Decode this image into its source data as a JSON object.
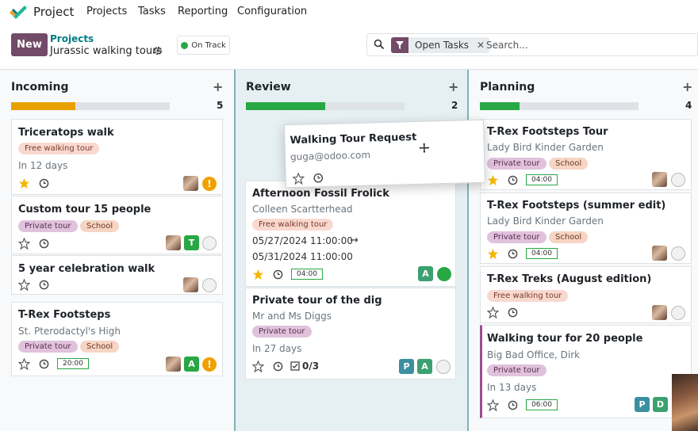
{
  "nav": {
    "app_name": "Project",
    "menu": [
      "Projects",
      "Tasks",
      "Reporting",
      "Configuration"
    ]
  },
  "control_panel": {
    "new_label": "New",
    "breadcrumb_parent": "Projects",
    "breadcrumb_current": "Jurassic walking tours",
    "status_label": "On Track",
    "search_facet": "Open Tasks",
    "search_placeholder": "Search..."
  },
  "colors": {
    "brand": "#714b67",
    "link": "#017e84",
    "incoming_progress": "#e8a000",
    "progress_green": "#28a745",
    "review_column_bg": "#e6f0f2"
  },
  "columns": [
    {
      "title": "Incoming",
      "count": "5",
      "progress": 0.4,
      "cards": [
        {
          "title": "Triceratops walk",
          "tags": [
            "Free walking tour"
          ],
          "deadline": "In 12 days",
          "starred": true,
          "avatars": [
            "photo"
          ],
          "status": "warning"
        },
        {
          "title": "Custom tour 15 people",
          "tags": [
            "Private tour",
            "School"
          ],
          "starred": false,
          "avatars": [
            "photo",
            "T"
          ],
          "status": "normal"
        },
        {
          "title": "5 year celebration walk",
          "starred": false,
          "avatars": [
            "photo"
          ],
          "status": "normal"
        },
        {
          "title": "T-Rex Footsteps",
          "subtitle": "St. Pterodactyl's High",
          "tags": [
            "Private tour",
            "School"
          ],
          "time": "20:00",
          "starred": false,
          "avatars": [
            "photo",
            "A"
          ],
          "status": "warning"
        }
      ]
    },
    {
      "title": "Review",
      "count": "2",
      "progress": 0.5,
      "cards": [
        {
          "title": "Afternoon Fossil Frolick",
          "subtitle": "Colleen Scartterhead",
          "tags": [
            "Free walking tour"
          ],
          "date_start": "05/27/2024 11:00:00",
          "date_end": "05/31/2024 11:00:00",
          "arrow": "→",
          "time": "04:00",
          "starred": true,
          "avatars": [
            "A"
          ],
          "status": "done"
        },
        {
          "title": "Private tour of the dig",
          "subtitle": "Mr and Ms Diggs",
          "tags": [
            "Private tour"
          ],
          "deadline": "In 27 days",
          "subtasks": "0/3",
          "starred": false,
          "avatars": [
            "P",
            "A"
          ],
          "status": "normal"
        }
      ]
    },
    {
      "title": "Planning",
      "count": "4",
      "progress": 0.25,
      "cards": [
        {
          "title": "T-Rex Footsteps Tour",
          "subtitle": "Lady Bird Kinder Garden",
          "tags": [
            "Private tour",
            "School"
          ],
          "time": "04:00",
          "starred": true,
          "avatars": [
            "photo"
          ],
          "status": "normal"
        },
        {
          "title": "T-Rex Footsteps (summer edit)",
          "subtitle": "Lady Bird Kinder Garden",
          "tags": [
            "Private tour",
            "School"
          ],
          "time": "04:00",
          "starred": true,
          "avatars": [
            "photo"
          ],
          "status": "normal"
        },
        {
          "title": "T-Rex Treks (August edition)",
          "tags": [
            "Free walking tour"
          ],
          "starred": false,
          "avatars": [
            "photo"
          ],
          "status": "normal"
        },
        {
          "title": "Walking tour for 20 people",
          "subtitle": "Big Bad Office, Dirk",
          "tags": [
            "Private tour"
          ],
          "deadline": "In 13 days",
          "time": "06:00",
          "starred": false,
          "avatars": [
            "P",
            "D"
          ],
          "status": "none"
        }
      ]
    }
  ],
  "dragged_card": {
    "title": "Walking Tour Request",
    "email": "guga@odoo.com",
    "starred": false
  }
}
